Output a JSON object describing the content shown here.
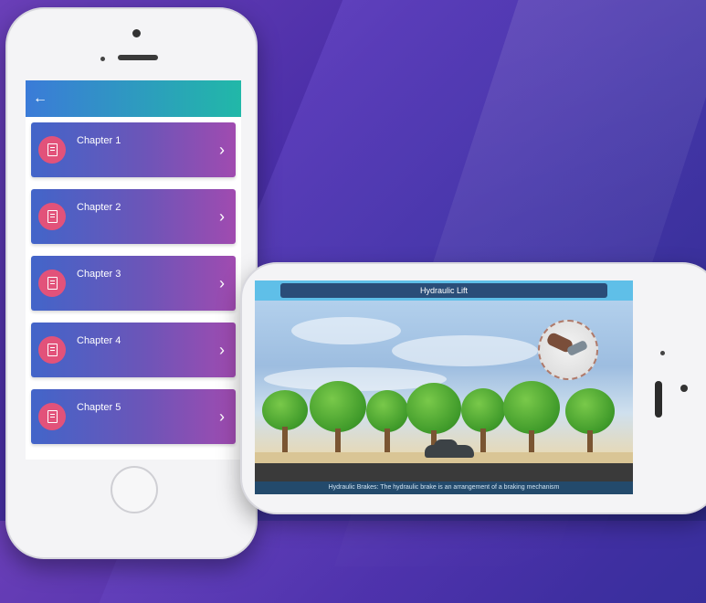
{
  "app": {
    "chapters": [
      {
        "label": "Chapter 1"
      },
      {
        "label": "Chapter 2"
      },
      {
        "label": "Chapter 3"
      },
      {
        "label": "Chapter 4"
      },
      {
        "label": "Chapter 5"
      }
    ],
    "back_icon": "arrow-left-icon",
    "chevron_icon": "chevron-right-icon",
    "chapter_icon": "book-icon"
  },
  "simulation": {
    "title": "Hydraulic Lift",
    "caption": "Hydraulic Brakes: The hydraulic brake is an arrangement of a braking mechanism"
  },
  "colors": {
    "appbar_start": "#3b7bd8",
    "appbar_end": "#21b8a8",
    "chapter_start": "#4265c9",
    "chapter_end": "#a04bb0",
    "chapter_icon_bg": "#e2527a"
  }
}
